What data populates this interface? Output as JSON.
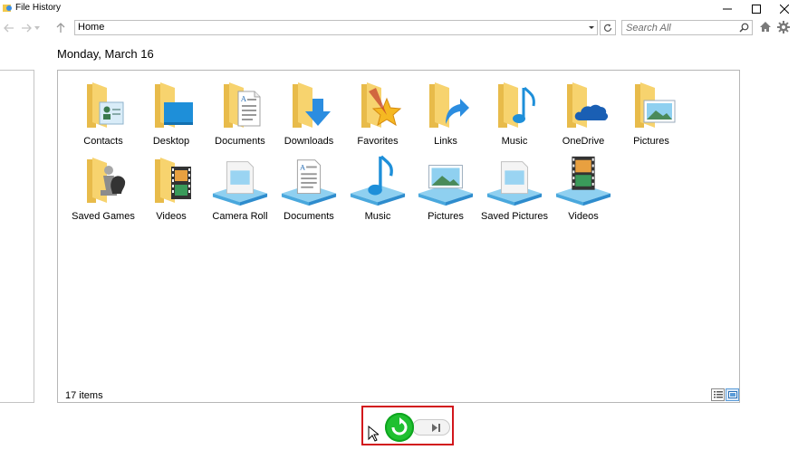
{
  "window": {
    "title": "File History"
  },
  "toolbar": {
    "address": "Home",
    "search_placeholder": "Search All"
  },
  "view": {
    "date": "Monday, March 16",
    "status": "17 items"
  },
  "items": [
    {
      "label": "Contacts",
      "icon": "contacts-folder-icon"
    },
    {
      "label": "Desktop",
      "icon": "desktop-folder-icon"
    },
    {
      "label": "Documents",
      "icon": "documents-folder-icon"
    },
    {
      "label": "Downloads",
      "icon": "downloads-folder-icon"
    },
    {
      "label": "Favorites",
      "icon": "favorites-folder-icon"
    },
    {
      "label": "Links",
      "icon": "links-folder-icon"
    },
    {
      "label": "Music",
      "icon": "music-folder-icon"
    },
    {
      "label": "OneDrive",
      "icon": "onedrive-folder-icon"
    },
    {
      "label": "Pictures",
      "icon": "pictures-folder-icon"
    },
    {
      "label": "Saved Games",
      "icon": "saved-games-folder-icon"
    },
    {
      "label": "Videos",
      "icon": "videos-folder-icon"
    },
    {
      "label": "Camera Roll",
      "icon": "camera-roll-library-icon"
    },
    {
      "label": "Documents",
      "icon": "documents-library-icon"
    },
    {
      "label": "Music",
      "icon": "music-library-icon"
    },
    {
      "label": "Pictures",
      "icon": "pictures-library-icon"
    },
    {
      "label": "Saved Pictures",
      "icon": "saved-pictures-library-icon"
    },
    {
      "label": "Videos",
      "icon": "videos-library-icon"
    }
  ],
  "colors": {
    "folder": "#f7d36e",
    "accent_blue": "#1e8fd9",
    "restore_green": "#20c030",
    "highlight_red": "#d2161c"
  }
}
